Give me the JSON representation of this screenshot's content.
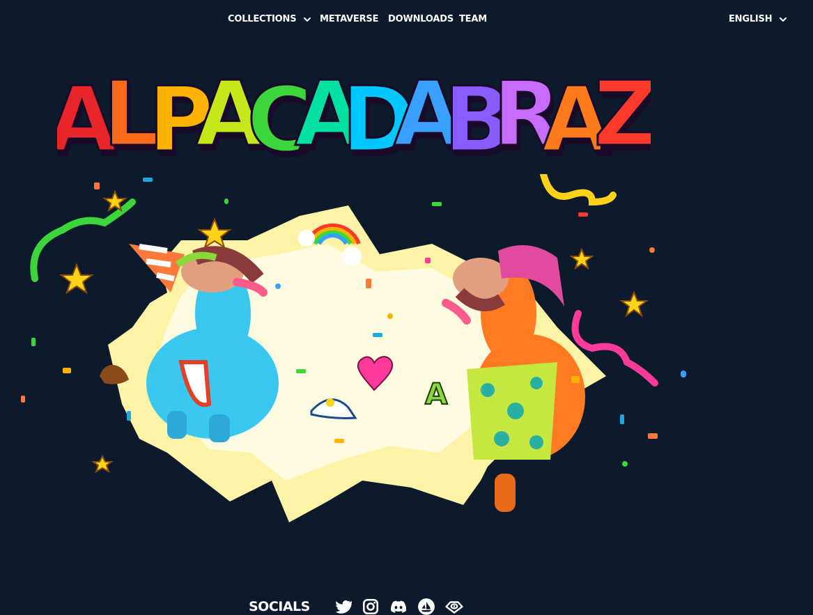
{
  "nav": {
    "collections": "COLLECTIONS",
    "metaverse": "METAVERSE",
    "downloads": "DOWNLOADS",
    "team": "TEAM",
    "language": "ENGLISH"
  },
  "hero": {
    "logo_text": "ALPACADABRAZ",
    "letter_colors": [
      "#e8262a",
      "#ff6a1a",
      "#ffb300",
      "#c6e81a",
      "#3cd63c",
      "#00e0a0",
      "#00c8ff",
      "#3aa0ff",
      "#8a5bff",
      "#c86bff",
      "#ff7a1a",
      "#ff3a2a"
    ]
  },
  "footer": {
    "socials_label": "SOCIALS",
    "icons": [
      "twitter-icon",
      "instagram-icon",
      "discord-icon",
      "opensea-icon",
      "looksrare-icon"
    ]
  },
  "colors": {
    "background": "#0c1a2c",
    "burst": "#fff3a8",
    "burst_inner": "#fffbe0"
  }
}
